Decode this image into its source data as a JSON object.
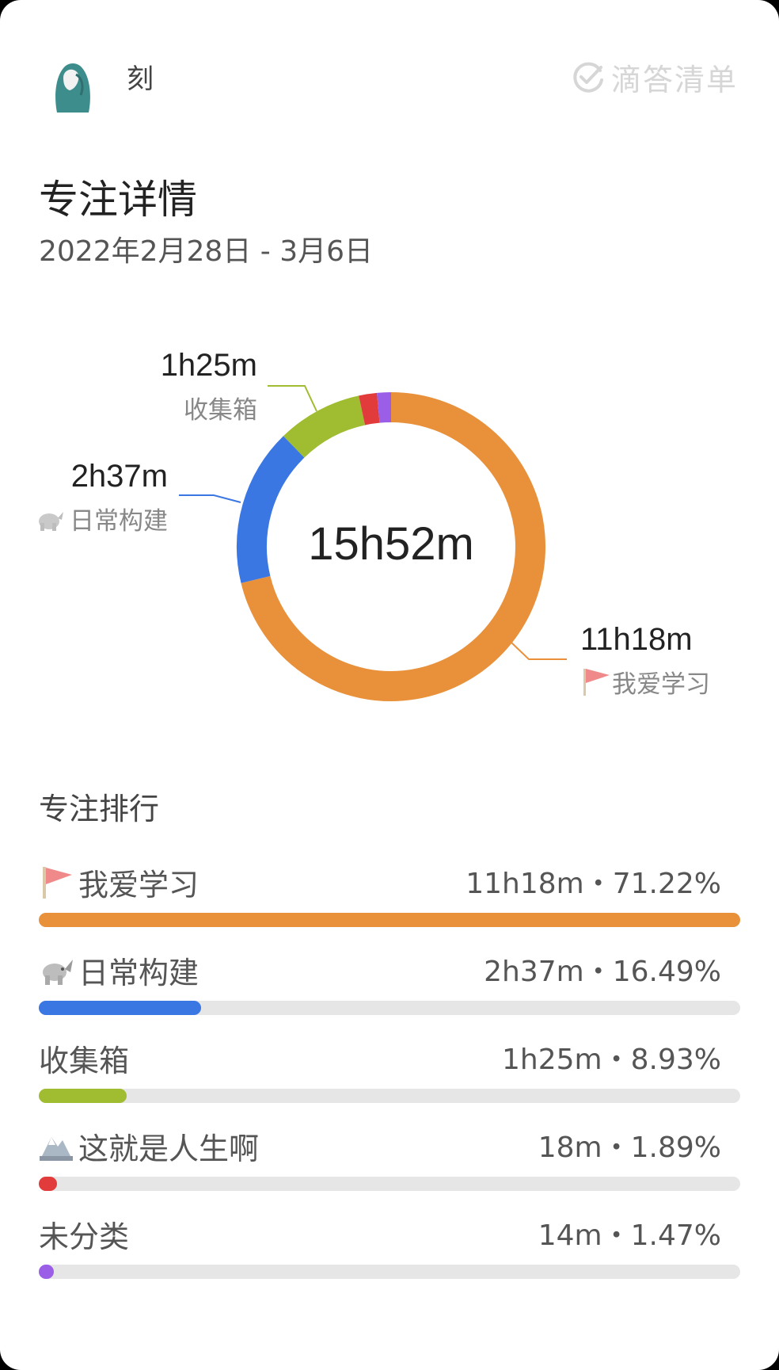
{
  "header": {
    "username": "刻",
    "brand": "滴答清单",
    "title": "专注详情",
    "date_range": "2022年2月28日 - 3月6日"
  },
  "chart_data": {
    "type": "pie",
    "center_total": "15h52m",
    "slices": [
      {
        "name": "我爱学习",
        "duration": "11h18m",
        "percent": 71.22,
        "color": "#e8913a",
        "icon": "red-flag-icon",
        "label": "我爱学习"
      },
      {
        "name": "日常构建",
        "duration": "2h37m",
        "percent": 16.49,
        "color": "#3b77e3",
        "icon": "rhino-icon",
        "label": "日常构建"
      },
      {
        "name": "收集箱",
        "duration": "1h25m",
        "percent": 8.93,
        "color": "#a0bc30",
        "icon": "",
        "label": "收集箱"
      },
      {
        "name": "这就是人生啊",
        "duration": "18m",
        "percent": 1.89,
        "color": "#e23b3b",
        "icon": "mountain-icon"
      },
      {
        "name": "未分类",
        "duration": "14m",
        "percent": 1.47,
        "color": "#9b5ee6",
        "icon": ""
      }
    ]
  },
  "ranking": {
    "title": "专注排行",
    "items": [
      {
        "label": "我爱学习",
        "value": "11h18m・71.22%",
        "fraction": 1.0,
        "color": "#e8913a",
        "icon": "red-flag-icon"
      },
      {
        "label": "日常构建",
        "value": "2h37m・16.49%",
        "fraction": 0.231,
        "color": "#3b77e3",
        "icon": "rhino-icon"
      },
      {
        "label": "收集箱",
        "value": "1h25m・8.93%",
        "fraction": 0.125,
        "color": "#a0bc30",
        "icon": ""
      },
      {
        "label": "这就是人生啊",
        "value": "18m・1.89%",
        "fraction": 0.026,
        "color": "#e23b3b",
        "icon": "mountain-icon"
      },
      {
        "label": "未分类",
        "value": "14m・1.47%",
        "fraction": 0.02,
        "color": "#9b5ee6",
        "icon": ""
      }
    ]
  }
}
